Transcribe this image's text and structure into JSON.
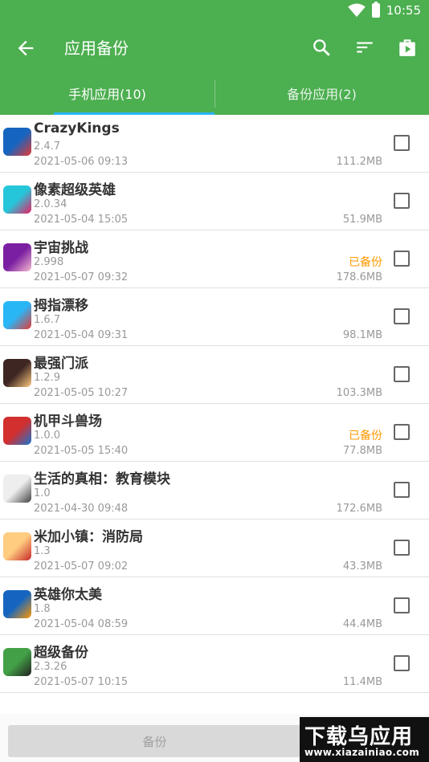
{
  "status_bar": {
    "time": "10:55"
  },
  "app_bar": {
    "title": "应用备份"
  },
  "tabs": [
    {
      "label": "手机应用(10)",
      "active": true
    },
    {
      "label": "备份应用(2)",
      "active": false
    }
  ],
  "apps": [
    {
      "name": "CrazyKings",
      "version": "2.4.7",
      "date": "2021-05-06 09:13",
      "size": "111.2MB",
      "status": "",
      "icon_colors": [
        "#1565c0",
        "#e53935"
      ]
    },
    {
      "name": "像素超级英雄",
      "version": "2.0.34",
      "date": "2021-05-04 15:05",
      "size": "51.9MB",
      "status": "",
      "icon_colors": [
        "#26c6da",
        "#e91e63"
      ]
    },
    {
      "name": "宇宙挑战",
      "version": "2.998",
      "date": "2021-05-07 09:32",
      "size": "178.6MB",
      "status": "已备份",
      "icon_colors": [
        "#7b1fa2",
        "#f8bbd0"
      ]
    },
    {
      "name": "拇指漂移",
      "version": "1.6.7",
      "date": "2021-05-04 09:31",
      "size": "98.1MB",
      "status": "",
      "icon_colors": [
        "#29b6f6",
        "#e53935"
      ]
    },
    {
      "name": "最强门派",
      "version": "1.2.9",
      "date": "2021-05-05 10:27",
      "size": "103.3MB",
      "status": "",
      "icon_colors": [
        "#3e2723",
        "#ffcc80"
      ]
    },
    {
      "name": "机甲斗兽场",
      "version": "1.0.0",
      "date": "2021-05-05 15:40",
      "size": "77.8MB",
      "status": "已备份",
      "icon_colors": [
        "#d32f2f",
        "#1976d2"
      ]
    },
    {
      "name": "生活的真相：教育模块",
      "version": "1.0",
      "date": "2021-04-30 09:48",
      "size": "172.6MB",
      "status": "",
      "icon_colors": [
        "#eeeeee",
        "#424242"
      ]
    },
    {
      "name": "米加小镇：消防局",
      "version": "1.3",
      "date": "2021-05-07 09:02",
      "size": "43.3MB",
      "status": "",
      "icon_colors": [
        "#ffcc80",
        "#c62828"
      ]
    },
    {
      "name": "英雄你太美",
      "version": "1.8",
      "date": "2021-05-04 08:59",
      "size": "44.4MB",
      "status": "",
      "icon_colors": [
        "#1565c0",
        "#ff9800"
      ]
    },
    {
      "name": "超级备份",
      "version": "2.3.26",
      "date": "2021-05-07 10:15",
      "size": "11.4MB",
      "status": "",
      "icon_colors": [
        "#43a047",
        "#212121"
      ]
    }
  ],
  "bottom": {
    "backup_label": "备份"
  },
  "watermark": {
    "title": "下载乌应用",
    "url": "www.xiazainiao.com"
  },
  "colors": {
    "primary": "#4caf50",
    "accent": "#29b6f6",
    "backed_up": "#ff9800"
  }
}
